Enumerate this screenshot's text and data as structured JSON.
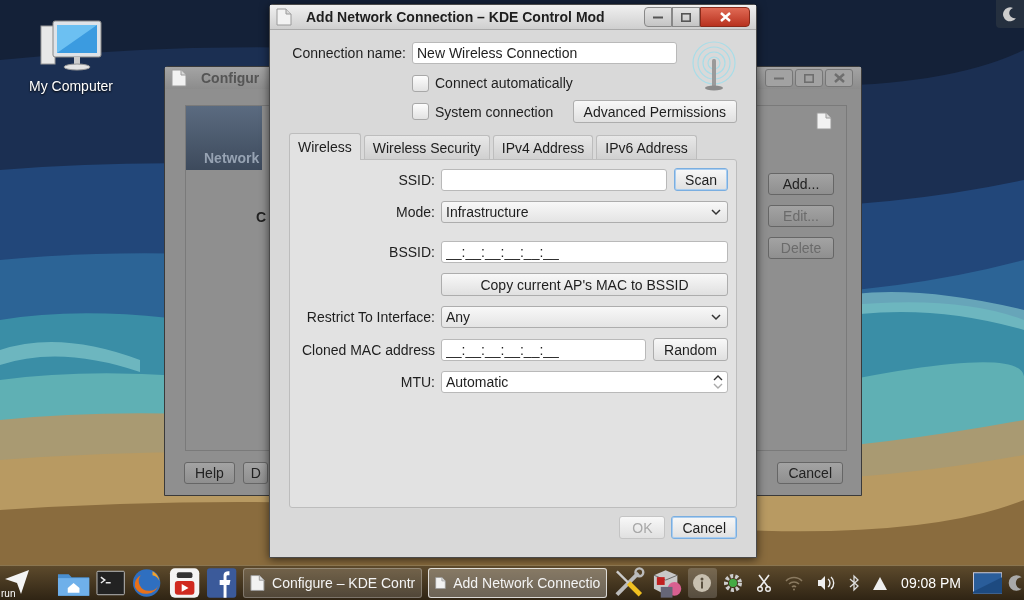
{
  "desktop": {
    "icons": [
      {
        "label": "My Computer"
      }
    ]
  },
  "background_window": {
    "title": "Configur",
    "sidebar": [
      {
        "label": "Network",
        "selected": true
      }
    ],
    "content_text": "C",
    "side_buttons": [
      {
        "label": "Add...",
        "disabled": false
      },
      {
        "label": "Edit...",
        "disabled": true
      },
      {
        "label": "Delete",
        "disabled": true
      }
    ],
    "footer_left": [
      {
        "label": "Help"
      },
      {
        "label": "D"
      }
    ],
    "footer_right": [
      {
        "label": "Cancel"
      }
    ]
  },
  "dialog": {
    "title": "Add Network Connection – KDE Control Mod",
    "connection_name": {
      "label": "Connection name:",
      "value": "New Wireless Connection"
    },
    "options": [
      {
        "label": "Connect automatically",
        "checked": false
      },
      {
        "label": "System connection",
        "checked": false
      }
    ],
    "permissions_button": "Advanced Permissions",
    "tabs": [
      {
        "label": "Wireless",
        "selected": true
      },
      {
        "label": "Wireless Security",
        "selected": false
      },
      {
        "label": "IPv4 Address",
        "selected": false
      },
      {
        "label": "IPv6 Address",
        "selected": false
      }
    ],
    "fields": [
      {
        "kind": "text",
        "label": "SSID:",
        "button": {
          "label": "Scan",
          "focused": true
        }
      },
      {
        "kind": "combo",
        "label": "Mode:",
        "value": "Infrastructure"
      },
      {
        "kind": "text",
        "label": "BSSID:",
        "value": "__:__:__:__:__:__"
      },
      {
        "kind": "button",
        "label": "Copy current AP's MAC to BSSID"
      },
      {
        "kind": "combo",
        "label": "Restrict To Interface:",
        "value": "Any"
      },
      {
        "kind": "text",
        "label": "Cloned MAC address",
        "value": "__:__:__:__:__:__",
        "button": {
          "label": "Random",
          "focused": false
        }
      },
      {
        "kind": "spin",
        "label": "MTU:",
        "value": "Automatic"
      }
    ],
    "buttons": [
      {
        "label": "OK",
        "disabled": true,
        "focused": false
      },
      {
        "label": "Cancel",
        "disabled": false,
        "focused": true
      }
    ]
  },
  "taskbar": {
    "launcher": "run",
    "tasks": [
      {
        "label": "Configure – KDE Contr",
        "selected": false
      },
      {
        "label": "Add Network Connectio",
        "selected": true
      }
    ],
    "clock": "09:08 PM"
  }
}
